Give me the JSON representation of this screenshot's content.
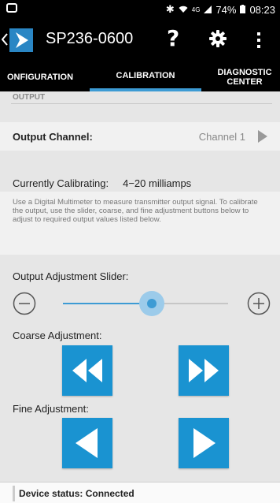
{
  "status_bar": {
    "battery": "74%",
    "time": "08:23",
    "network": "4G"
  },
  "app_bar": {
    "title": "SP236-0600",
    "help_label": "?"
  },
  "tabs": [
    {
      "label": "ONFIGURATION",
      "active": false
    },
    {
      "label": "CALIBRATION",
      "active": true
    },
    {
      "label": "DIAGNOSTIC\nCENTER",
      "active": false
    }
  ],
  "section_title": "OUTPUT",
  "output_channel": {
    "label": "Output Channel:",
    "value": "Channel 1"
  },
  "calibrating": {
    "label": "Currently Calibrating:",
    "value": "4−20 milliamps"
  },
  "instructions": "Use a Digital Multimeter to measure transmitter output signal. To calibrate the output, use the slider, coarse, and fine adjustment buttons below to adjust to required output values listed below.",
  "slider": {
    "label": "Output Adjustment Slider:",
    "value_fraction": 0.5
  },
  "coarse_label": "Coarse Adjustment:",
  "fine_label": "Fine Adjustment:",
  "device_status": "Device status:  Connected",
  "colors": {
    "accent": "#3d9bd4",
    "button": "#1a93d1"
  }
}
